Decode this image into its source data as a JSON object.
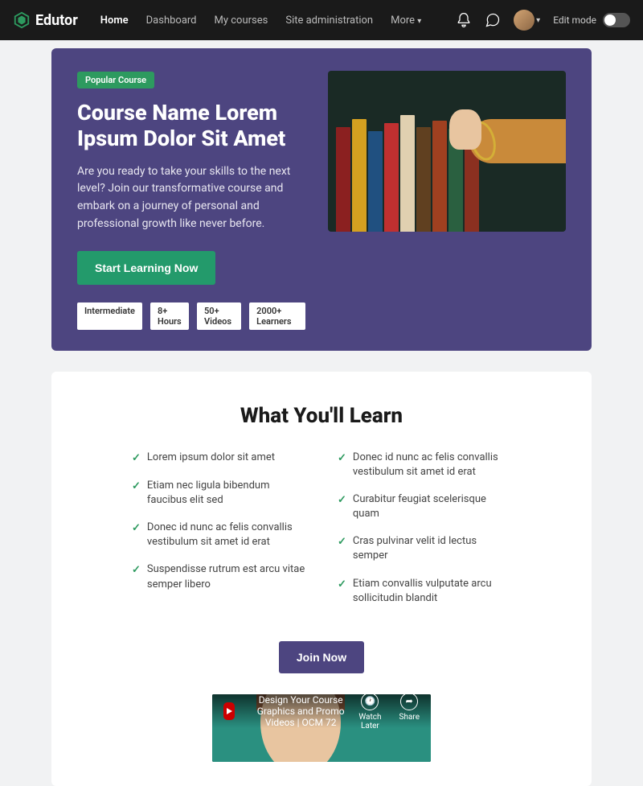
{
  "brand": "Edutor",
  "nav": {
    "home": "Home",
    "dashboard": "Dashboard",
    "mycourses": "My courses",
    "siteadmin": "Site administration",
    "more": "More"
  },
  "editmode_label": "Edit mode",
  "hero": {
    "badge": "Popular Course",
    "title": "Course Name Lorem Ipsum Dolor Sit Amet",
    "desc": "Are you ready to take your skills to the next level? Join our transformative course and embark on a journey of personal and professional growth like never before.",
    "cta": "Start Learning Now",
    "stats": {
      "level": "Intermediate",
      "hours": "8+ Hours",
      "videos": "50+ Videos",
      "learners": "2000+ Learners"
    }
  },
  "learn": {
    "heading": "What You'll Learn",
    "left": [
      "Lorem ipsum dolor sit amet",
      "Etiam nec ligula bibendum faucibus elit sed",
      "Donec id nunc ac felis convallis vestibulum sit amet id erat",
      "Suspendisse rutrum est arcu vitae semper libero"
    ],
    "right": [
      "Donec id nunc ac felis convallis vestibulum sit amet id erat",
      "Curabitur feugiat scelerisque quam",
      "Cras pulvinar velit id lectus semper",
      "Etiam convallis vulputate arcu sollicitudin blandit"
    ],
    "join": "Join Now"
  },
  "video": {
    "title": "Design Your Course Graphics and Promo Videos | OCM 72",
    "watch_later": "Watch Later",
    "share": "Share"
  }
}
